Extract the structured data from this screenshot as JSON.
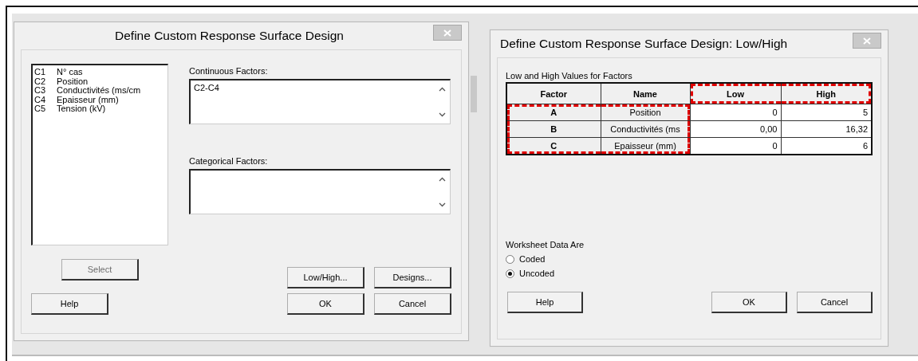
{
  "left_dialog": {
    "title": "Define Custom Response Surface Design",
    "variables": [
      {
        "column": "C1",
        "name": "N° cas"
      },
      {
        "column": "C2",
        "name": "Position"
      },
      {
        "column": "C3",
        "name": "Conductivités (ms/cm"
      },
      {
        "column": "C4",
        "name": "Epaisseur (mm)"
      },
      {
        "column": "C5",
        "name": "Tension (kV)"
      }
    ],
    "continuous_factors": {
      "label": "Continuous Factors:",
      "value": "C2-C4"
    },
    "categorical_factors": {
      "label": "Categorical Factors:"
    },
    "buttons": [
      {
        "label": "Select",
        "disabled": true
      },
      {
        "label": "Low/High...",
        "disabled": false
      },
      {
        "label": "Designs...",
        "disabled": false
      },
      {
        "label": "Help",
        "disabled": false
      },
      {
        "label": "OK",
        "disabled": false
      },
      {
        "label": "Cancel",
        "disabled": false
      }
    ]
  },
  "right_dialog": {
    "title": "Define Custom Response Surface Design: Low/High",
    "table_label": "Low and High Values for Factors",
    "table": {
      "columns": [
        {
          "label": "Factor",
          "header_highlighted": false,
          "body_highlighted": true
        },
        {
          "label": "Name",
          "header_highlighted": false,
          "body_highlighted": true
        },
        {
          "label": "Low",
          "header_highlighted": true,
          "body_highlighted": false
        },
        {
          "label": "High",
          "header_highlighted": true,
          "body_highlighted": false
        }
      ],
      "rows": [
        [
          "A",
          "Position",
          "0",
          "5"
        ],
        [
          "B",
          "Conductivités (ms",
          "0,00",
          "16,32"
        ],
        [
          "C",
          "Epaisseur (mm)",
          "0",
          "6"
        ]
      ]
    },
    "worksheet_label": "Worksheet Data Are",
    "options": [
      {
        "label": "Coded",
        "selected": false
      },
      {
        "label": "Uncoded",
        "selected": true
      }
    ],
    "buttons": [
      {
        "label": "Help"
      },
      {
        "label": "OK"
      },
      {
        "label": "Cancel"
      }
    ]
  }
}
